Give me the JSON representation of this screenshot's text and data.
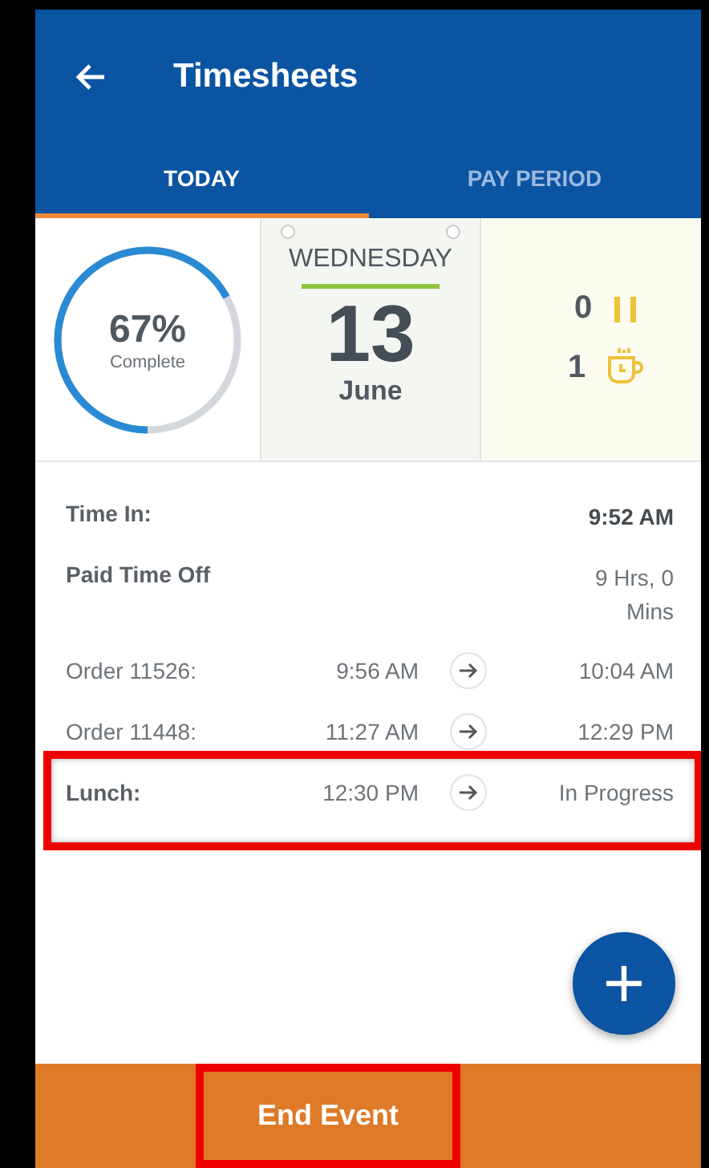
{
  "header": {
    "title": "Timesheets"
  },
  "tabs": [
    {
      "label": "TODAY",
      "selected": true
    },
    {
      "label": "PAY PERIOD",
      "selected": false
    }
  ],
  "progress": {
    "percent": "67%",
    "caption": "Complete",
    "level": 0.67
  },
  "calendar": {
    "weekday": "WEDNESDAY",
    "day": "13",
    "month": "June"
  },
  "counters": [
    {
      "kind": "break",
      "count": "0"
    },
    {
      "kind": "lunch",
      "count": "1"
    }
  ],
  "entries": [
    {
      "kind": "total",
      "label": "Time In:",
      "value": "9:52 AM",
      "label_bold": true,
      "value_bold": true,
      "highlighted": false
    },
    {
      "kind": "total",
      "label": "Paid Time Off",
      "value": "9 Hrs, 0 Mins",
      "label_bold": true,
      "value_bold": false,
      "highlighted": false
    },
    {
      "kind": "event",
      "label": "Order 11526:",
      "start": "9:56 AM",
      "end": "10:04 AM",
      "label_bold": false,
      "highlighted": false
    },
    {
      "kind": "event",
      "label": "Order 11448:",
      "start": "11:27 AM",
      "end": "12:29 PM",
      "label_bold": false,
      "highlighted": false
    },
    {
      "kind": "event",
      "label": "Lunch:",
      "start": "12:30 PM",
      "end": "In Progress",
      "label_bold": true,
      "highlighted": true
    }
  ],
  "end_button": {
    "label": "End Event",
    "highlighted": true
  }
}
